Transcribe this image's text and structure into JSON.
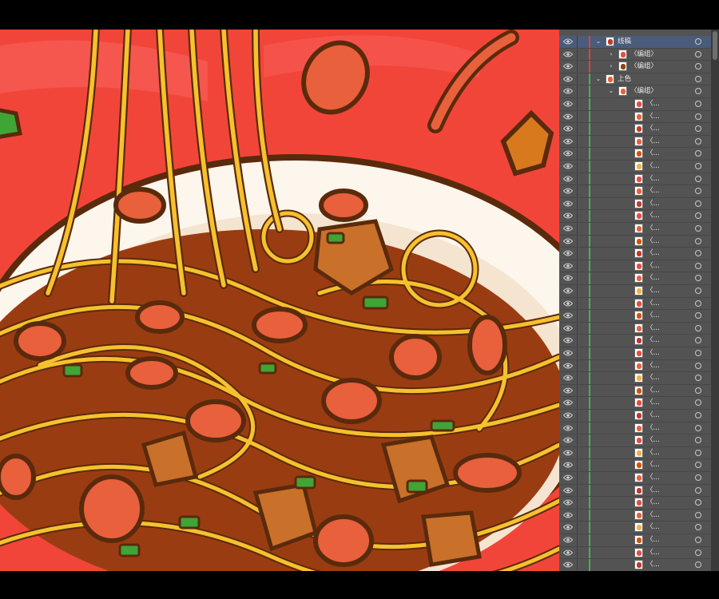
{
  "layers_panel": {
    "layers": [
      {
        "label": "线稿",
        "level": 0,
        "expanded": true,
        "color": "#e04040",
        "selected": true,
        "swatch": "#c0392b"
      },
      {
        "label": "〈编组〉",
        "level": 1,
        "expanded": false,
        "color": "#e04040",
        "swatch": "#e74c3c"
      },
      {
        "label": "〈编组〉",
        "level": 1,
        "expanded": false,
        "color": "#e04040",
        "swatch": "#8b4513"
      },
      {
        "label": "上色",
        "level": 0,
        "expanded": true,
        "color": "#4caf50",
        "swatch": "#e8603c"
      },
      {
        "label": "〈编组〉",
        "level": 1,
        "expanded": true,
        "color": "#4caf50",
        "swatch": "#e8603c"
      },
      {
        "label": "〈...",
        "level": 2,
        "color": "#4caf50",
        "swatch": "#e74c3c"
      },
      {
        "label": "〈...",
        "level": 2,
        "color": "#4caf50",
        "swatch": "#e8603c"
      },
      {
        "label": "〈...",
        "level": 2,
        "color": "#4caf50",
        "swatch": "#c0392b"
      },
      {
        "label": "〈...",
        "level": 2,
        "color": "#4caf50",
        "swatch": "#e8603c"
      },
      {
        "label": "〈...",
        "level": 2,
        "color": "#4caf50",
        "swatch": "#d35400"
      },
      {
        "label": "〈...",
        "level": 2,
        "color": "#4caf50",
        "swatch": "#f5b041"
      },
      {
        "label": "〈...",
        "level": 2,
        "color": "#4caf50",
        "swatch": "#e74c3c"
      },
      {
        "label": "〈...",
        "level": 2,
        "color": "#4caf50",
        "swatch": "#e8603c"
      },
      {
        "label": "〈...",
        "level": 2,
        "color": "#4caf50",
        "swatch": "#c0392b"
      },
      {
        "label": "〈...",
        "level": 2,
        "color": "#4caf50",
        "swatch": "#e74c3c"
      },
      {
        "label": "〈...",
        "level": 2,
        "color": "#4caf50",
        "swatch": "#e8603c"
      },
      {
        "label": "〈...",
        "level": 2,
        "color": "#4caf50",
        "swatch": "#d35400"
      },
      {
        "label": "〈...",
        "level": 2,
        "color": "#4caf50",
        "swatch": "#c0392b"
      },
      {
        "label": "〈...",
        "level": 2,
        "color": "#4caf50",
        "swatch": "#e74c3c"
      },
      {
        "label": "〈...",
        "level": 2,
        "color": "#4caf50",
        "swatch": "#e8603c"
      },
      {
        "label": "〈...",
        "level": 2,
        "color": "#4caf50",
        "swatch": "#f5b041"
      },
      {
        "label": "〈...",
        "level": 2,
        "color": "#4caf50",
        "swatch": "#e74c3c"
      },
      {
        "label": "〈...",
        "level": 2,
        "color": "#4caf50",
        "swatch": "#d35400"
      },
      {
        "label": "〈...",
        "level": 2,
        "color": "#4caf50",
        "swatch": "#e8603c"
      },
      {
        "label": "〈...",
        "level": 2,
        "color": "#4caf50",
        "swatch": "#c0392b"
      },
      {
        "label": "〈...",
        "level": 2,
        "color": "#4caf50",
        "swatch": "#e74c3c"
      },
      {
        "label": "〈...",
        "level": 2,
        "color": "#4caf50",
        "swatch": "#e8603c"
      },
      {
        "label": "〈...",
        "level": 2,
        "color": "#4caf50",
        "swatch": "#f5b041"
      },
      {
        "label": "〈...",
        "level": 2,
        "color": "#4caf50",
        "swatch": "#d35400"
      },
      {
        "label": "〈...",
        "level": 2,
        "color": "#4caf50",
        "swatch": "#e74c3c"
      },
      {
        "label": "〈...",
        "level": 2,
        "color": "#4caf50",
        "swatch": "#c0392b"
      },
      {
        "label": "〈...",
        "level": 2,
        "color": "#4caf50",
        "swatch": "#e8603c"
      },
      {
        "label": "〈...",
        "level": 2,
        "color": "#4caf50",
        "swatch": "#e74c3c"
      },
      {
        "label": "〈...",
        "level": 2,
        "color": "#4caf50",
        "swatch": "#f5b041"
      },
      {
        "label": "〈...",
        "level": 2,
        "color": "#4caf50",
        "swatch": "#d35400"
      },
      {
        "label": "〈...",
        "level": 2,
        "color": "#4caf50",
        "swatch": "#e8603c"
      },
      {
        "label": "〈...",
        "level": 2,
        "color": "#4caf50",
        "swatch": "#c0392b"
      },
      {
        "label": "〈...",
        "level": 2,
        "color": "#4caf50",
        "swatch": "#e74c3c"
      },
      {
        "label": "〈...",
        "level": 2,
        "color": "#4caf50",
        "swatch": "#e8603c"
      },
      {
        "label": "〈...",
        "level": 2,
        "color": "#4caf50",
        "swatch": "#f5b041"
      },
      {
        "label": "〈...",
        "level": 2,
        "color": "#4caf50",
        "swatch": "#d35400"
      },
      {
        "label": "〈...",
        "level": 2,
        "color": "#4caf50",
        "swatch": "#e74c3c"
      },
      {
        "label": "〈...",
        "level": 2,
        "color": "#4caf50",
        "swatch": "#c0392b"
      }
    ]
  },
  "colors": {
    "background_red": "#f2453a",
    "plate": "#fdf6ec",
    "noodle": "#f6c12d",
    "outline": "#5a2a0c",
    "sauce": "#d9541e",
    "green": "#3fa535"
  }
}
